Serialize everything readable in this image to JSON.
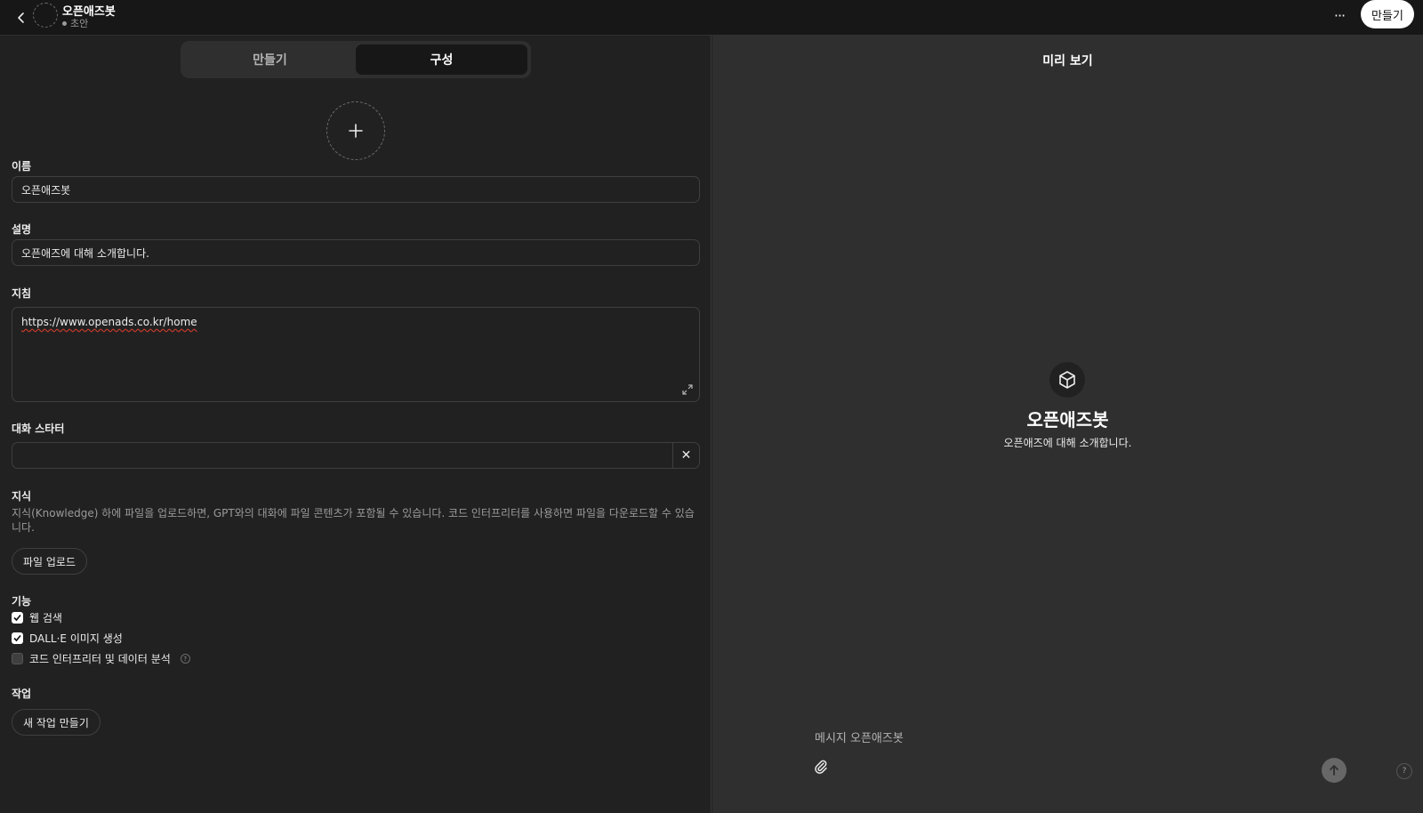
{
  "header": {
    "bot_name": "오픈애즈봇",
    "status": "초안",
    "more_label": "···",
    "create_label": "만들기",
    "back_icon": "chevron-left-icon"
  },
  "tabs": [
    {
      "label": "만들기",
      "active": false
    },
    {
      "label": "구성",
      "active": true
    }
  ],
  "form": {
    "add_avatar_icon": "plus-icon",
    "name_label": "이름",
    "name_value": "오픈애즈봇",
    "description_label": "설명",
    "description_value": "오픈애즈에 대해 소개합니다.",
    "instructions_label": "지침",
    "instructions_value": "https://www.openads.co.kr/home",
    "starters_label": "대화 스타터",
    "starters_value": "",
    "starters_clear": "✕",
    "knowledge_label": "지식",
    "knowledge_desc": "지식(Knowledge) 하에 파일을 업로드하면, GPT와의 대화에 파일 콘텐츠가 포함될 수 있습니다. 코드 인터프리터를 사용하면 파일을 다운로드할 수 있습니다.",
    "upload_label": "파일 업로드",
    "capabilities_label": "기능",
    "capabilities": [
      {
        "label": "웹 검색",
        "checked": true
      },
      {
        "label": "DALL·E 이미지 생성",
        "checked": true
      },
      {
        "label": "코드 인터프리터 및 데이터 분석",
        "checked": false
      }
    ],
    "actions_label": "작업",
    "new_action_label": "새 작업 만들기"
  },
  "preview": {
    "title": "미리 보기",
    "bot_name": "오픈애즈봇",
    "bot_desc": "오픈애즈에 대해 소개합니다.",
    "icon": "cube-icon",
    "message_placeholder": "메시지 오픈애즈봇",
    "help": "?"
  }
}
